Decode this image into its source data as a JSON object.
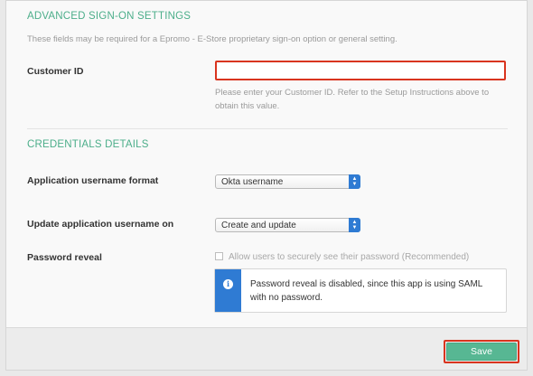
{
  "advanced": {
    "title": "ADVANCED SIGN-ON SETTINGS",
    "description": "These fields may be required for a Epromo - E-Store proprietary sign-on option or general setting.",
    "customer_id": {
      "label": "Customer ID",
      "value": "",
      "help": "Please enter your Customer ID. Refer to the Setup Instructions above to obtain this value."
    }
  },
  "credentials": {
    "title": "CREDENTIALS DETAILS",
    "username_format": {
      "label": "Application username format",
      "selected": "Okta username"
    },
    "update_on": {
      "label": "Update application username on",
      "selected": "Create and update"
    },
    "password_reveal": {
      "label": "Password reveal",
      "checkbox_label": "Allow users to securely see their password (Recommended)",
      "checked": false,
      "info_message": "Password reveal is disabled, since this app is using SAML with no password."
    }
  },
  "footer": {
    "save_label": "Save"
  },
  "colors": {
    "accent_green": "#4cae8a",
    "highlight_red": "#d9341f",
    "info_blue": "#2f7bd3",
    "save_green": "#57b793"
  }
}
